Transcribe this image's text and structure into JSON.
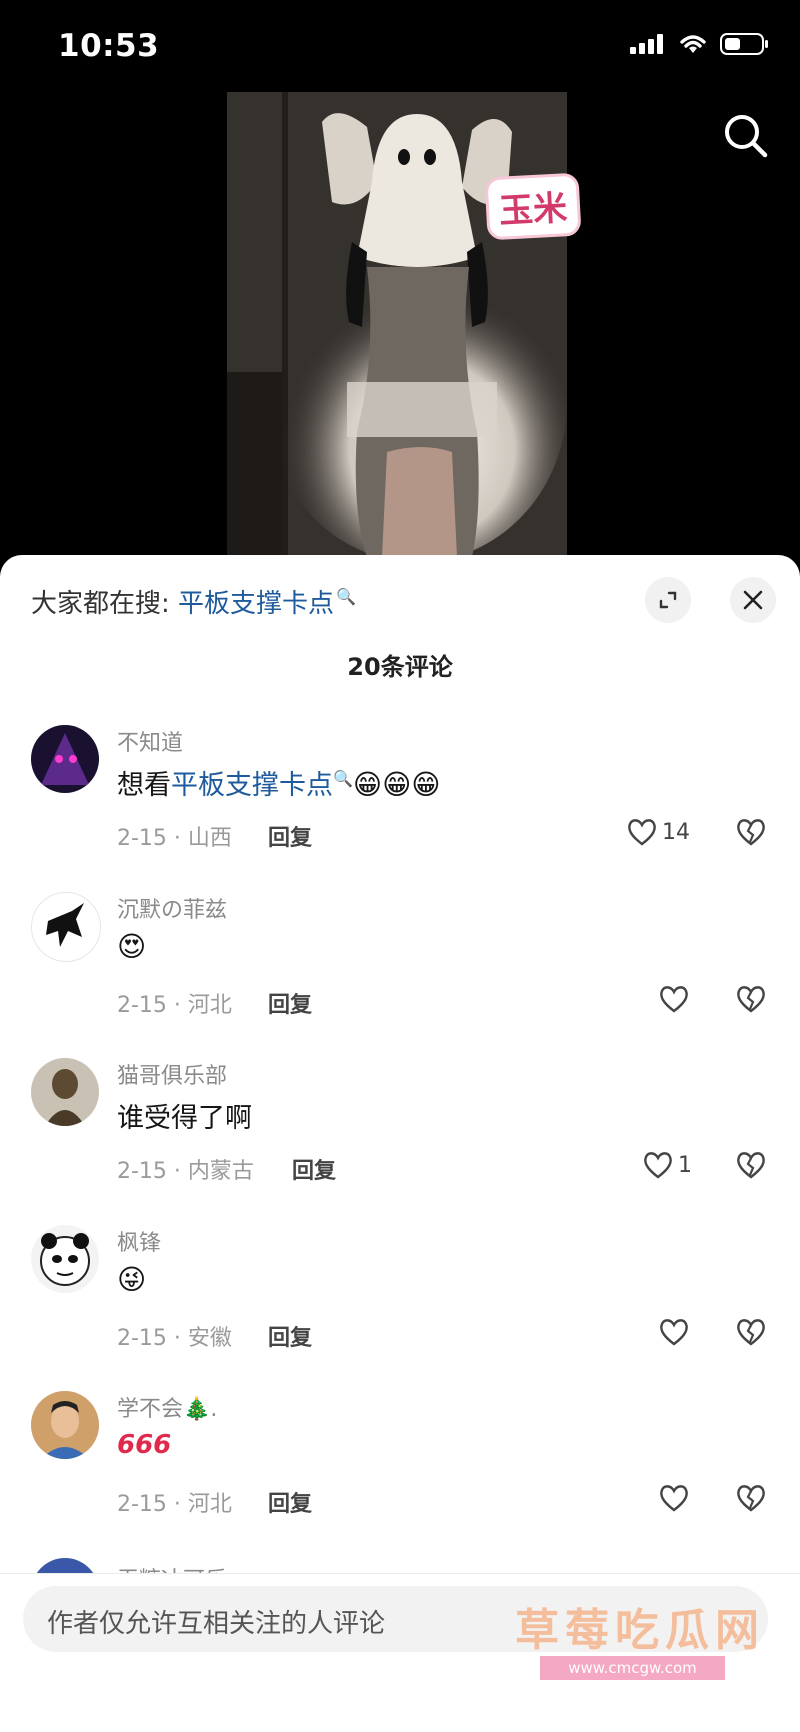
{
  "status_bar": {
    "time": "10:53"
  },
  "video": {
    "sticker_text": "玉米"
  },
  "sheet": {
    "hot_search_label": "大家都在搜: ",
    "hot_search_term": "平板支撑卡点",
    "comment_count": "20条评论"
  },
  "comments": [
    {
      "user": "不知道",
      "text_prefix": "想看",
      "text_highlight": "平板支撑卡点",
      "emoji": "😁😁😁",
      "meta": "2-15 · 山西",
      "reply": "回复",
      "likes": "14"
    },
    {
      "user": "沉默の菲兹",
      "text_prefix": "",
      "text_highlight": "",
      "emoji": "😍",
      "meta": "2-15 · 河北",
      "reply": "回复",
      "likes": ""
    },
    {
      "user": "猫哥俱乐部",
      "text_prefix": "谁受得了啊",
      "text_highlight": "",
      "emoji": "",
      "meta": "2-15 · 内蒙古",
      "reply": "回复",
      "likes": "1"
    },
    {
      "user": "枫锋",
      "text_prefix": "",
      "text_highlight": "",
      "emoji": "😜",
      "meta": "2-15 · 安徽",
      "reply": "回复",
      "likes": ""
    },
    {
      "user": "学不会🎄.",
      "text_prefix": "",
      "text_highlight": "",
      "emoji": "666",
      "meta": "2-15 · 河北",
      "reply": "回复",
      "likes": ""
    }
  ],
  "partial_comment_user": "无糖冰可乐",
  "bottom_bar": {
    "input_placeholder": "作者仅允许互相关注的人评论",
    "watermark": "草莓吃瓜网",
    "watermark_url": "www.cmcgw.com"
  },
  "colors": {
    "link_blue": "#1f5b9c",
    "sheet_bg": "#ffffff",
    "top_bg": "#000000"
  }
}
